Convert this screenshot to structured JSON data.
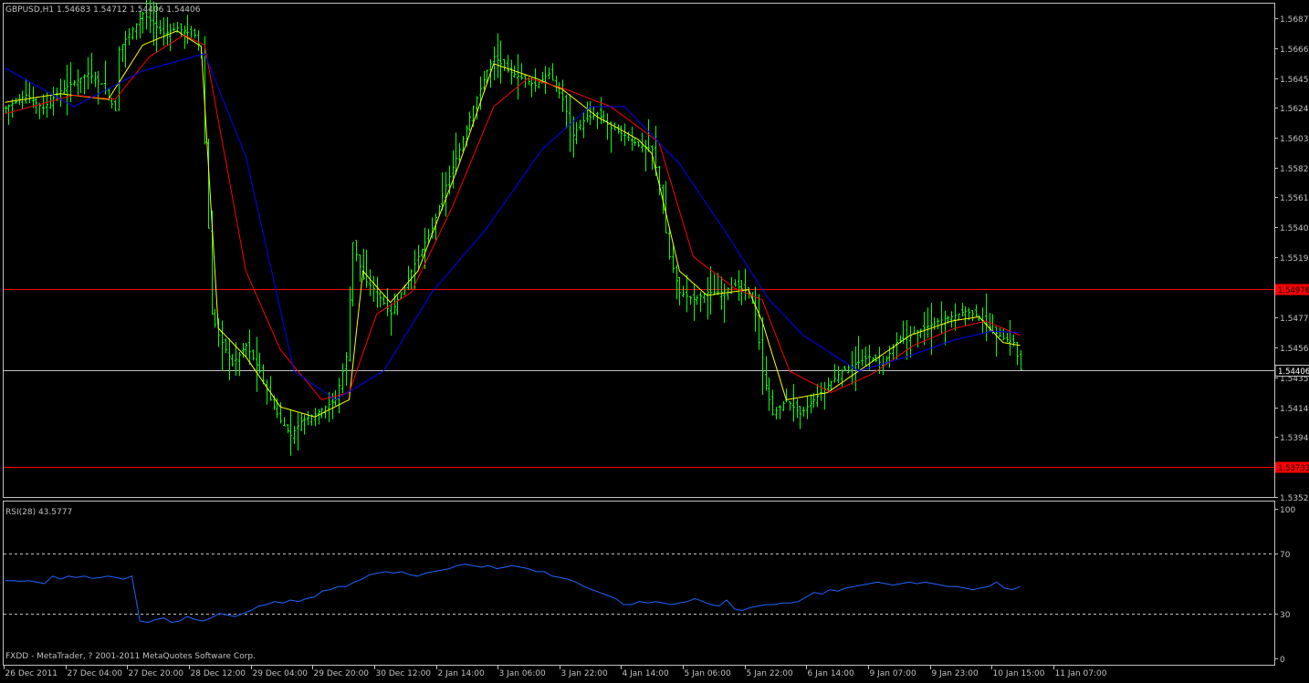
{
  "header": {
    "symbol_line": "GBPUSD,H1  1.54683 1.54712 1.54406 1.54406",
    "rsi_line": "RSI(28) 43.5777",
    "footer_line": "FXDD - MetaTrader, ? 2001-2011 MetaQuotes Software Corp."
  },
  "colors": {
    "background": "#000000",
    "bars": "#00ff00",
    "ma_fast": "#ffff00",
    "ma_mid": "#ff0000",
    "ma_slow": "#0000ff",
    "rsi": "#1e64ff",
    "level_red": "#ff0000",
    "frame": "#c0c0c0"
  },
  "chart_data": [
    {
      "type": "line",
      "title": "GBPUSD,H1",
      "ylim": [
        1.5352,
        1.5697
      ],
      "y_tick_labels": [
        "1.56870",
        "1.56660",
        "1.56450",
        "1.56240",
        "1.56030",
        "1.55825",
        "1.55615",
        "1.55405",
        "1.55195",
        "1.54985",
        "1.54775",
        "1.54565",
        "1.54355",
        "1.54145",
        "1.53940",
        "1.53520"
      ],
      "x_tick_labels": [
        "26 Dec 2011",
        "27 Dec 04:00",
        "27 Dec 20:00",
        "28 Dec 12:00",
        "29 Dec 04:00",
        "29 Dec 20:00",
        "30 Dec 12:00",
        "2 Jan 14:00",
        "3 Jan 06:00",
        "3 Jan 22:00",
        "4 Jan 14:00",
        "5 Jan 06:00",
        "5 Jan 22:00",
        "6 Jan 14:00",
        "9 Jan 07:00",
        "9 Jan 23:00",
        "10 Jan 15:00",
        "11 Jan 07:00"
      ],
      "horizontal_levels": [
        {
          "value": 1.54976,
          "label": "1.54976",
          "color": "#ff0000"
        },
        {
          "value": 1.53733,
          "label": "1.53733",
          "color": "#ff0000"
        },
        {
          "value": 1.54406,
          "label": "1.54406",
          "color": "#c0c0c0"
        }
      ],
      "close_path": [
        [
          0,
          1.5624
        ],
        [
          6,
          1.5633
        ],
        [
          11,
          1.5624
        ],
        [
          16,
          1.5636
        ],
        [
          24,
          1.5648
        ],
        [
          28,
          1.5641
        ],
        [
          32,
          1.5622
        ],
        [
          33,
          1.5665
        ],
        [
          40,
          1.569
        ],
        [
          46,
          1.5676
        ],
        [
          50,
          1.568
        ],
        [
          55,
          1.5675
        ],
        [
          57,
          1.5662
        ],
        [
          58,
          1.56
        ],
        [
          60,
          1.548
        ],
        [
          62,
          1.5465
        ],
        [
          66,
          1.5445
        ],
        [
          70,
          1.5458
        ],
        [
          74,
          1.544
        ],
        [
          77,
          1.542
        ],
        [
          80,
          1.5405
        ],
        [
          83,
          1.5395
        ],
        [
          86,
          1.5405
        ],
        [
          90,
          1.541
        ],
        [
          93,
          1.5415
        ],
        [
          96,
          1.542
        ],
        [
          99,
          1.545
        ],
        [
          101,
          1.553
        ],
        [
          104,
          1.5505
        ],
        [
          108,
          1.5495
        ],
        [
          112,
          1.548
        ],
        [
          116,
          1.55
        ],
        [
          120,
          1.552
        ],
        [
          124,
          1.554
        ],
        [
          128,
          1.557
        ],
        [
          132,
          1.5595
        ],
        [
          136,
          1.5625
        ],
        [
          140,
          1.565
        ],
        [
          142,
          1.566
        ],
        [
          146,
          1.565
        ],
        [
          150,
          1.5645
        ],
        [
          154,
          1.564
        ],
        [
          158,
          1.5648
        ],
        [
          162,
          1.563
        ],
        [
          165,
          1.5605
        ],
        [
          168,
          1.5615
        ],
        [
          172,
          1.562
        ],
        [
          176,
          1.561
        ],
        [
          180,
          1.5605
        ],
        [
          184,
          1.5598
        ],
        [
          188,
          1.5595
        ],
        [
          190,
          1.557
        ],
        [
          193,
          1.552
        ],
        [
          196,
          1.5495
        ],
        [
          200,
          1.549
        ],
        [
          204,
          1.5495
        ],
        [
          208,
          1.5495
        ],
        [
          212,
          1.55
        ],
        [
          216,
          1.5495
        ],
        [
          218,
          1.548
        ],
        [
          220,
          1.544
        ],
        [
          223,
          1.541
        ],
        [
          227,
          1.542
        ],
        [
          231,
          1.541
        ],
        [
          235,
          1.542
        ],
        [
          239,
          1.543
        ],
        [
          243,
          1.544
        ],
        [
          247,
          1.5445
        ],
        [
          251,
          1.545
        ],
        [
          255,
          1.5445
        ],
        [
          259,
          1.546
        ],
        [
          263,
          1.5465
        ],
        [
          267,
          1.547
        ],
        [
          271,
          1.5475
        ],
        [
          275,
          1.5478
        ],
        [
          279,
          1.5482
        ],
        [
          283,
          1.5478
        ],
        [
          287,
          1.5468
        ],
        [
          290,
          1.5463
        ],
        [
          293,
          1.546
        ],
        [
          295,
          1.5441
        ]
      ],
      "moving_averages": [
        {
          "color": "#ffff00",
          "path": [
            [
              0,
              1.5628
            ],
            [
              16,
              1.5634
            ],
            [
              30,
              1.563
            ],
            [
              40,
              1.5668
            ],
            [
              50,
              1.5678
            ],
            [
              57,
              1.5667
            ],
            [
              62,
              1.547
            ],
            [
              70,
              1.545
            ],
            [
              80,
              1.5415
            ],
            [
              90,
              1.5408
            ],
            [
              100,
              1.542
            ],
            [
              104,
              1.551
            ],
            [
              112,
              1.5488
            ],
            [
              120,
              1.551
            ],
            [
              132,
              1.5585
            ],
            [
              142,
              1.5655
            ],
            [
              154,
              1.5645
            ],
            [
              162,
              1.5637
            ],
            [
              172,
              1.5618
            ],
            [
              184,
              1.5602
            ],
            [
              188,
              1.5592
            ],
            [
              196,
              1.551
            ],
            [
              204,
              1.5493
            ],
            [
              216,
              1.5497
            ],
            [
              220,
              1.5475
            ],
            [
              227,
              1.542
            ],
            [
              239,
              1.5425
            ],
            [
              251,
              1.5445
            ],
            [
              263,
              1.5465
            ],
            [
              275,
              1.5475
            ],
            [
              283,
              1.5478
            ],
            [
              290,
              1.546
            ],
            [
              295,
              1.5458
            ]
          ]
        },
        {
          "color": "#ff0000",
          "path": [
            [
              0,
              1.562
            ],
            [
              20,
              1.5633
            ],
            [
              32,
              1.563
            ],
            [
              42,
              1.566
            ],
            [
              52,
              1.5675
            ],
            [
              58,
              1.5668
            ],
            [
              70,
              1.551
            ],
            [
              80,
              1.5455
            ],
            [
              92,
              1.542
            ],
            [
              100,
              1.5425
            ],
            [
              108,
              1.548
            ],
            [
              118,
              1.5495
            ],
            [
              130,
              1.5555
            ],
            [
              142,
              1.5625
            ],
            [
              152,
              1.5645
            ],
            [
              162,
              1.5638
            ],
            [
              176,
              1.5625
            ],
            [
              190,
              1.56
            ],
            [
              200,
              1.552
            ],
            [
              212,
              1.5498
            ],
            [
              220,
              1.549
            ],
            [
              228,
              1.544
            ],
            [
              240,
              1.5425
            ],
            [
              252,
              1.5438
            ],
            [
              264,
              1.5458
            ],
            [
              276,
              1.547
            ],
            [
              285,
              1.5475
            ],
            [
              295,
              1.5465
            ]
          ]
        },
        {
          "color": "#0000ff",
          "path": [
            [
              0,
              1.5652
            ],
            [
              20,
              1.5625
            ],
            [
              40,
              1.565
            ],
            [
              58,
              1.5662
            ],
            [
              70,
              1.559
            ],
            [
              84,
              1.544
            ],
            [
              96,
              1.542
            ],
            [
              110,
              1.544
            ],
            [
              124,
              1.5495
            ],
            [
              140,
              1.554
            ],
            [
              156,
              1.5595
            ],
            [
              170,
              1.5625
            ],
            [
              180,
              1.5625
            ],
            [
              196,
              1.5585
            ],
            [
              210,
              1.5535
            ],
            [
              222,
              1.549
            ],
            [
              232,
              1.5465
            ],
            [
              248,
              1.544
            ],
            [
              262,
              1.545
            ],
            [
              276,
              1.5462
            ],
            [
              287,
              1.5468
            ],
            [
              295,
              1.5467
            ]
          ]
        }
      ]
    },
    {
      "type": "line",
      "title": "RSI(28)",
      "ylim": [
        0,
        100
      ],
      "y_tick_labels": [
        "100",
        "70",
        "30",
        "0"
      ],
      "levels": [
        70,
        30
      ],
      "series": [
        {
          "name": "RSI(28)",
          "values": [
            52,
            52,
            51.5,
            52,
            51,
            50,
            55,
            53,
            55,
            54,
            55,
            53.5,
            54,
            55,
            54,
            53,
            55,
            25,
            24,
            26,
            27,
            24,
            25,
            28,
            26,
            25,
            27,
            30,
            29,
            28,
            30,
            32,
            35,
            36,
            38,
            37,
            39,
            38,
            40,
            41,
            45,
            46,
            48,
            48,
            51,
            53,
            56,
            57,
            58,
            57,
            58,
            56,
            55,
            57,
            58,
            59,
            60,
            62,
            63,
            62,
            61,
            62,
            60,
            61,
            62,
            61,
            60,
            58,
            58,
            55,
            54,
            53,
            51,
            48,
            46,
            44,
            42,
            40,
            36,
            36,
            38,
            37,
            38,
            37,
            36,
            37,
            38,
            40,
            38,
            36,
            35,
            39,
            33,
            32,
            34,
            35,
            36,
            36,
            37,
            37,
            38,
            41,
            44,
            43,
            46,
            45,
            47,
            48,
            49,
            50,
            51,
            50,
            49,
            50,
            51,
            50,
            51,
            50,
            49,
            48,
            48,
            47,
            46,
            47,
            48,
            51,
            47,
            46,
            48
          ]
        }
      ]
    }
  ]
}
